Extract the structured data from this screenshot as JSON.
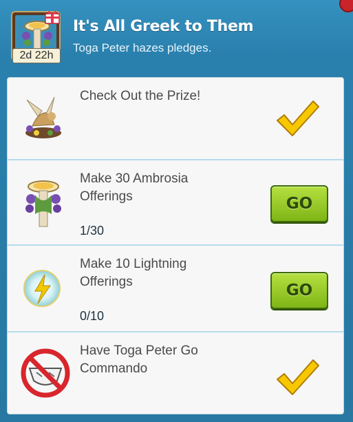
{
  "header": {
    "title": "It's All Greek to Them",
    "subtitle": "Toga Peter hazes pledges.",
    "timer": "2d 22h",
    "icon": "ambrosia-altar-icon",
    "gift_icon": "gift-icon"
  },
  "tasks": [
    {
      "label_line1": "Check Out the Prize!",
      "label_line2": "",
      "progress": "",
      "status": "complete",
      "icon": "winged-lion-statue-icon"
    },
    {
      "label_line1": "Make 30 Ambrosia",
      "label_line2": "Offerings",
      "progress": "1/30",
      "status": "go",
      "button_label": "GO",
      "icon": "ambrosia-altar-icon"
    },
    {
      "label_line1": "Make 10 Lightning",
      "label_line2": "Offerings",
      "progress": "0/10",
      "status": "go",
      "button_label": "GO",
      "icon": "lightning-orb-icon"
    },
    {
      "label_line1": "Have Toga Peter Go",
      "label_line2": "Commando",
      "progress": "",
      "status": "complete",
      "icon": "no-underwear-icon"
    }
  ],
  "colors": {
    "panel": "#2a80ad",
    "list_bg": "#f7f7f7",
    "go_button": "#9ccc2a",
    "check": "#f5c000"
  }
}
